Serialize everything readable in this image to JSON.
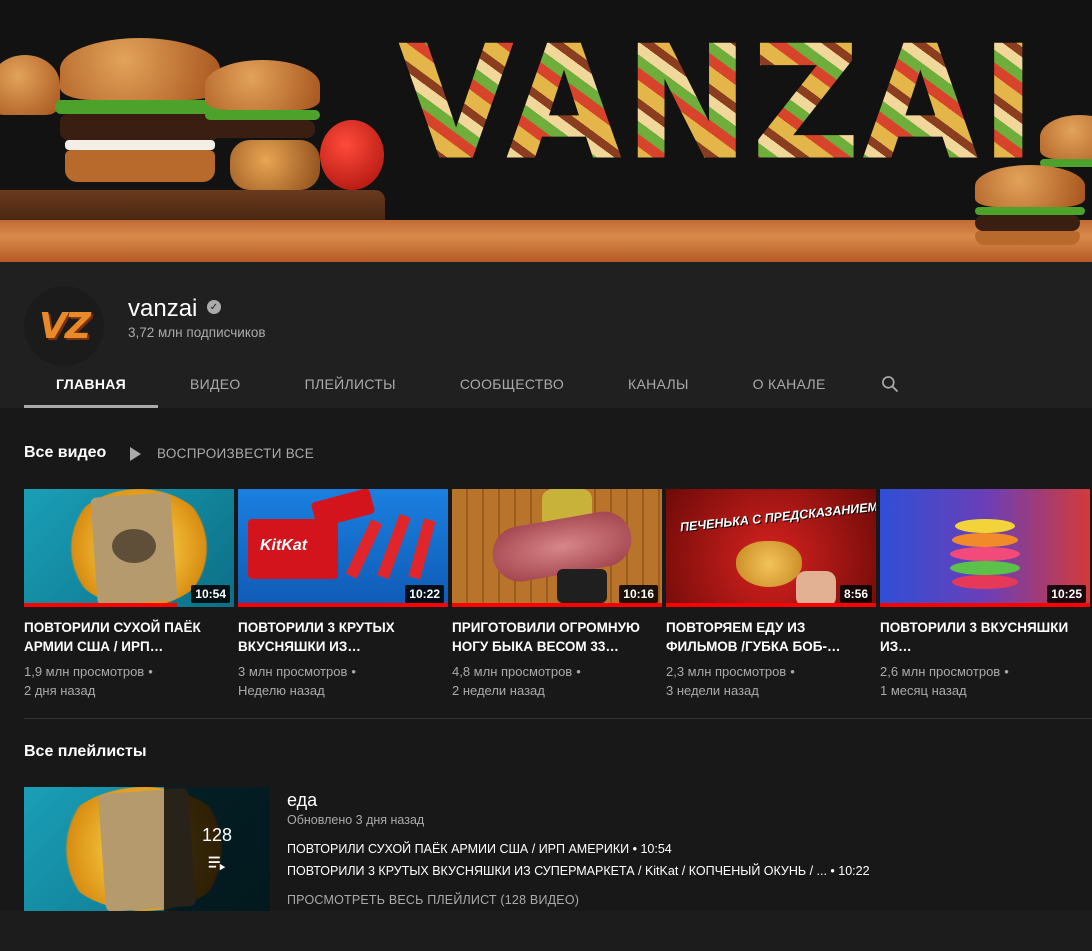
{
  "banner": {
    "title": "VANZAI"
  },
  "channel": {
    "avatar_text": "VZ",
    "name": "vanzai",
    "subscribers": "3,72 млн подписчиков"
  },
  "tabs": [
    {
      "label": "ГЛАВНАЯ",
      "active": true
    },
    {
      "label": "ВИДЕО"
    },
    {
      "label": "ПЛЕЙЛИСТЫ"
    },
    {
      "label": "СООБЩЕСТВО"
    },
    {
      "label": "КАНАЛЫ"
    },
    {
      "label": "О КАНАЛЕ"
    }
  ],
  "shelf": {
    "title": "Все видео",
    "play_all": "ВОСПРОИЗВЕСТИ ВСЕ",
    "videos": [
      {
        "title": "ПОВТОРИЛИ СУХОЙ ПАЁК АРМИИ США / ИРП…",
        "views": "1,9 млн просмотров",
        "age": "2 дня назад",
        "duration": "10:54",
        "watched": 0.73
      },
      {
        "title": "ПОВТОРИЛИ 3 КРУТЫХ ВКУСНЯШКИ ИЗ…",
        "views": "3 млн просмотров",
        "age": "Неделю назад",
        "duration": "10:22",
        "watched": 1.0
      },
      {
        "title": "ПРИГОТОВИЛИ ОГРОМНУЮ НОГУ БЫКА ВЕСОМ 33…",
        "views": "4,8 млн просмотров",
        "age": "2 недели назад",
        "duration": "10:16",
        "watched": 1.0
      },
      {
        "title": "ПОВТОРЯЕМ ЕДУ ИЗ ФИЛЬМОВ /губка боб-…",
        "views": "2,3 млн просмотров",
        "age": "3 недели назад",
        "duration": "8:56",
        "watched": 1.0,
        "thumb_text": "ПЕЧЕНЬКА С ПРЕДСКАЗАНИЕМ"
      },
      {
        "title": "ПОВТОРИЛИ 3 ВКУСНЯШКИ ИЗ…",
        "views": "2,6 млн просмотров",
        "age": "1 месяц назад",
        "duration": "10:25",
        "watched": 1.0
      }
    ]
  },
  "playlists": {
    "title": "Все плейлисты",
    "item": {
      "name": "еда",
      "updated": "Обновлено 3 дня назад",
      "count": "128",
      "entries": [
        "ПОВТОРИЛИ СУХОЙ ПАЁК АРМИИ США / ИРП АМЕРИКИ • 10:54",
        "ПОВТОРИЛИ 3 КРУТЫХ ВКУСНЯШКИ ИЗ СУПЕРМАРКЕТА / KitKat / КОПЧЕНЫЙ ОКУНЬ / ...  • 10:22"
      ],
      "view_all": "ПРОСМОТРЕТЬ ВЕСЬ ПЛЕЙЛИСТ (128 ВИДЕО)"
    }
  },
  "icons": {
    "search": "search-icon",
    "verified": "verified-check-icon",
    "play": "play-icon",
    "playlist": "playlist-icon"
  },
  "colors": {
    "accent_red": "#ff0000",
    "bg": "#181818",
    "header_bg": "#202020"
  }
}
